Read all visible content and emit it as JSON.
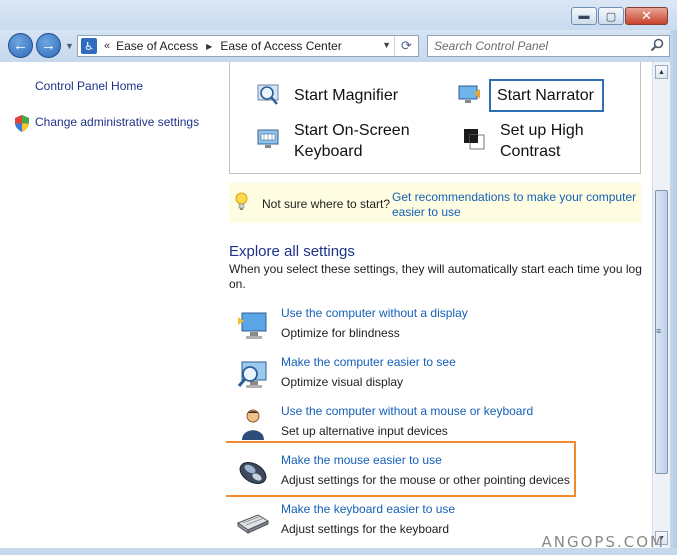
{
  "window": {
    "buttons": {
      "minimize": "▬",
      "maximize": "▢",
      "close": "✕"
    }
  },
  "nav": {
    "back_icon": "back-arrow-icon",
    "forward_icon": "forward-arrow-icon",
    "chevron": "«",
    "breadcrumbs": [
      "Ease of Access",
      "Ease of Access Center"
    ],
    "search_placeholder": "Search Control Panel"
  },
  "sidebar": {
    "items": [
      {
        "label": "Control Panel Home"
      },
      {
        "label": "Change administrative settings",
        "icon": "shield-icon"
      }
    ]
  },
  "quick_tools": [
    {
      "label": "Start Magnifier",
      "icon": "magnifier-icon"
    },
    {
      "label": "Start Narrator",
      "icon": "narrator-icon"
    },
    {
      "label_line1": "Start On-Screen",
      "label_line2": "Keyboard",
      "icon": "onscreen-keyboard-icon"
    },
    {
      "label_line1": "Set up High",
      "label_line2": "Contrast",
      "icon": "high-contrast-icon"
    }
  ],
  "tip": {
    "text": "Not sure where to start?",
    "link": "Get recommendations to make your computer easier to use"
  },
  "explore": {
    "title": "Explore all settings",
    "description": "When you select these settings, they will automatically start each time you log on.",
    "items": [
      {
        "link": "Use the computer without a display",
        "desc": "Optimize for blindness",
        "icon": "monitor-icon"
      },
      {
        "link": "Make the computer easier to see",
        "desc": "Optimize visual display",
        "icon": "magnified-monitor-icon"
      },
      {
        "link": "Use the computer without a mouse or keyboard",
        "desc": "Set up alternative input devices",
        "icon": "user-speech-icon"
      },
      {
        "link": "Make the mouse easier to use",
        "desc": "Adjust settings for the mouse or other pointing devices",
        "icon": "mouse-icon"
      },
      {
        "link": "Make the keyboard easier to use",
        "desc": "Adjust settings for the keyboard",
        "icon": "keyboard-icon"
      }
    ]
  },
  "watermark": "ANGOPS.COM",
  "colors": {
    "link": "#1460b8",
    "nav_link": "#1e3287",
    "highlight": "#f08a2f",
    "tip_bg": "#fffde1"
  }
}
